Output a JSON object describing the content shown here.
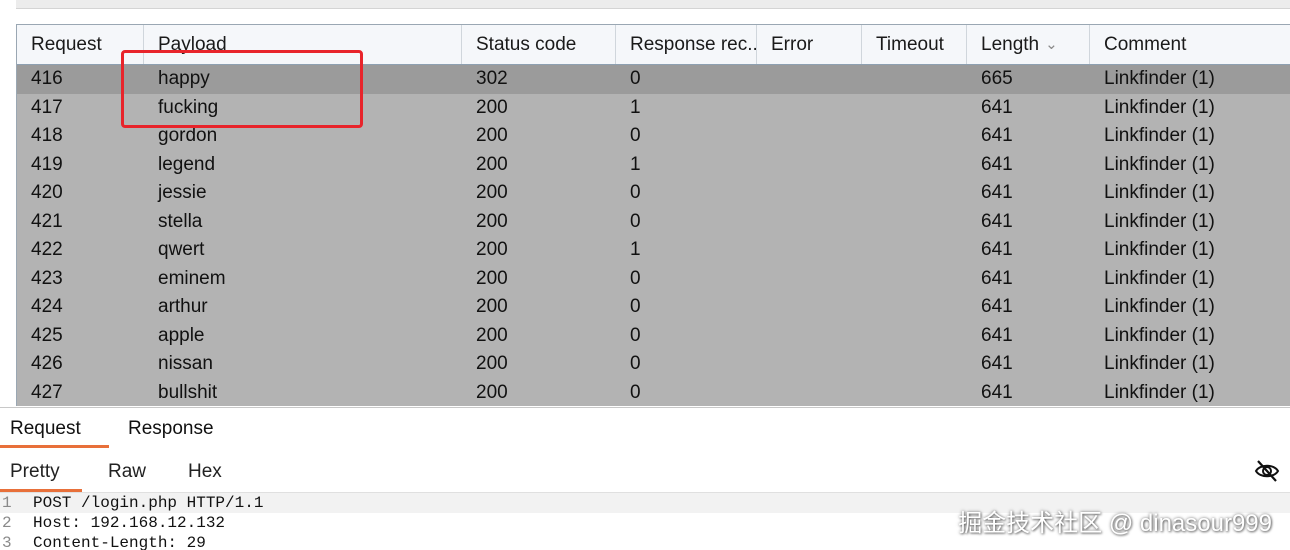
{
  "table": {
    "columns": [
      "Request",
      "Payload",
      "Status code",
      "Response rec...",
      "Error",
      "Timeout",
      "Length",
      "Comment"
    ],
    "rows": [
      {
        "request": "416",
        "payload": "happy",
        "status": "302",
        "response_received": "0",
        "error": "",
        "timeout": "",
        "length": "665",
        "comment": "Linkfinder (1)"
      },
      {
        "request": "417",
        "payload": "fucking",
        "status": "200",
        "response_received": "1",
        "error": "",
        "timeout": "",
        "length": "641",
        "comment": "Linkfinder (1)"
      },
      {
        "request": "418",
        "payload": "gordon",
        "status": "200",
        "response_received": "0",
        "error": "",
        "timeout": "",
        "length": "641",
        "comment": "Linkfinder (1)"
      },
      {
        "request": "419",
        "payload": "legend",
        "status": "200",
        "response_received": "1",
        "error": "",
        "timeout": "",
        "length": "641",
        "comment": "Linkfinder (1)"
      },
      {
        "request": "420",
        "payload": "jessie",
        "status": "200",
        "response_received": "0",
        "error": "",
        "timeout": "",
        "length": "641",
        "comment": "Linkfinder (1)"
      },
      {
        "request": "421",
        "payload": "stella",
        "status": "200",
        "response_received": "0",
        "error": "",
        "timeout": "",
        "length": "641",
        "comment": "Linkfinder (1)"
      },
      {
        "request": "422",
        "payload": "qwert",
        "status": "200",
        "response_received": "1",
        "error": "",
        "timeout": "",
        "length": "641",
        "comment": "Linkfinder (1)"
      },
      {
        "request": "423",
        "payload": "eminem",
        "status": "200",
        "response_received": "0",
        "error": "",
        "timeout": "",
        "length": "641",
        "comment": "Linkfinder (1)"
      },
      {
        "request": "424",
        "payload": "arthur",
        "status": "200",
        "response_received": "0",
        "error": "",
        "timeout": "",
        "length": "641",
        "comment": "Linkfinder (1)"
      },
      {
        "request": "425",
        "payload": "apple",
        "status": "200",
        "response_received": "0",
        "error": "",
        "timeout": "",
        "length": "641",
        "comment": "Linkfinder (1)"
      },
      {
        "request": "426",
        "payload": "nissan",
        "status": "200",
        "response_received": "0",
        "error": "",
        "timeout": "",
        "length": "641",
        "comment": "Linkfinder (1)"
      },
      {
        "request": "427",
        "payload": "bullshit",
        "status": "200",
        "response_received": "0",
        "error": "",
        "timeout": "",
        "length": "641",
        "comment": "Linkfinder (1)"
      }
    ],
    "sort_icon": "chevron-down-icon"
  },
  "tabs": {
    "request": "Request",
    "response": "Response"
  },
  "view_tabs": {
    "pretty": "Pretty",
    "raw": "Raw",
    "hex": "Hex",
    "toggle_icon": "eye-slash-icon"
  },
  "editor": {
    "lines": [
      {
        "num": "1",
        "text": "POST /login.php HTTP/1.1"
      },
      {
        "num": "2",
        "text": "Host: 192.168.12.132"
      },
      {
        "num": "3",
        "text": "Content-Length: 29"
      }
    ]
  },
  "watermark": "掘金技术社区 @ dinasour999",
  "colors": {
    "selection_highlight": "#e8242b",
    "tab_accent": "#e8703a",
    "row_background": "#b3b3b3",
    "selected_row": "#9b9b9b"
  }
}
